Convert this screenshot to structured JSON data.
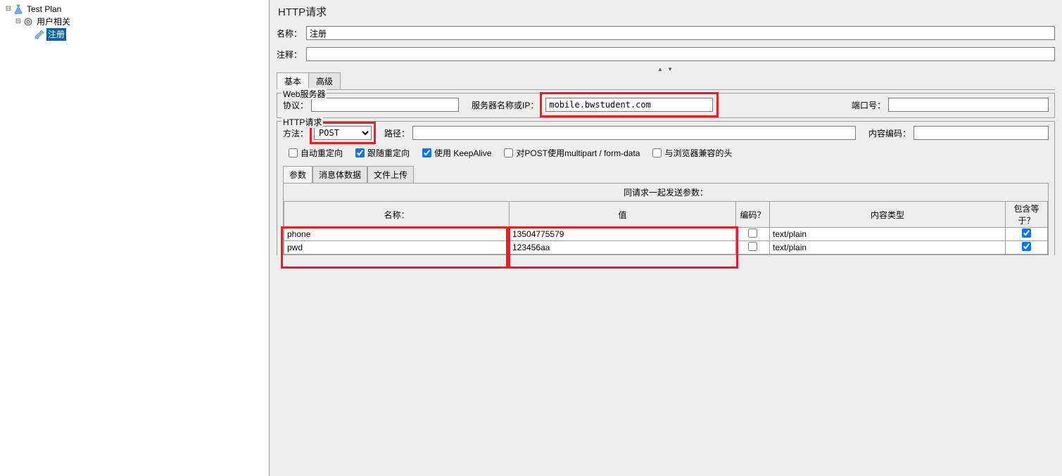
{
  "tree": {
    "root": "Test Plan",
    "group": "用户相关",
    "item": "注册"
  },
  "panel": {
    "title": "HTTP请求",
    "name_label": "名称：",
    "name_value": "注册",
    "comment_label": "注释：",
    "comment_value": ""
  },
  "tabs": {
    "basic": "基本",
    "advanced": "高级"
  },
  "webserver": {
    "legend": "Web服务器",
    "protocol_label": "协议：",
    "protocol_value": "",
    "server_label": "服务器名称或IP：",
    "server_value": "mobile.bwstudent.com",
    "port_label": "端口号：",
    "port_value": ""
  },
  "httpreq": {
    "legend": "HTTP请求",
    "method_label": "方法：",
    "method_value": "POST",
    "path_label": "路径：",
    "path_value": "",
    "encoding_label": "内容编码：",
    "encoding_value": ""
  },
  "checks": {
    "auto_redirect": "自动重定向",
    "follow_redirect": "跟随重定向",
    "keepalive": "使用 KeepAlive",
    "multipart": "对POST使用multipart / form-data",
    "browser_compat": "与浏览器兼容的头"
  },
  "ptabs": {
    "params": "参数",
    "body": "消息体数据",
    "files": "文件上传"
  },
  "ptable": {
    "caption": "同请求一起发送参数：",
    "headers": {
      "name": "名称：",
      "value": "值",
      "encode": "编码？",
      "ctype": "内容类型",
      "include": "包含等于？"
    },
    "rows": [
      {
        "name": "phone",
        "value": "13504775579",
        "encode": false,
        "ctype": "text/plain",
        "include": true
      },
      {
        "name": "pwd",
        "value": "123456aa",
        "encode": false,
        "ctype": "text/plain",
        "include": true
      }
    ]
  }
}
